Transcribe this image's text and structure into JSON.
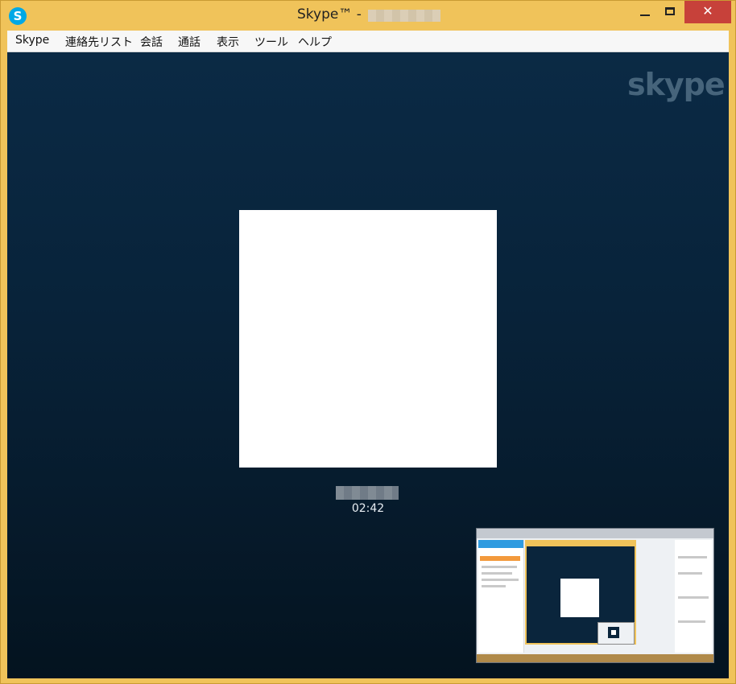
{
  "window": {
    "title": "Skype™ - ",
    "app_icon_glyph": "S",
    "buttons": {
      "minimize": "minimize-icon",
      "maximize": "maximize-icon",
      "close": "✕"
    }
  },
  "menu": {
    "items": [
      "Skype",
      "連絡先リスト",
      "会話",
      "通話",
      "表示",
      "ツール",
      "ヘルプ"
    ]
  },
  "call": {
    "brand": "skype",
    "duration": "02:42"
  },
  "colors": {
    "frame": "#f0c35a",
    "close": "#c7413a",
    "background_top": "#0b2a45",
    "background_bottom": "#04131f"
  }
}
